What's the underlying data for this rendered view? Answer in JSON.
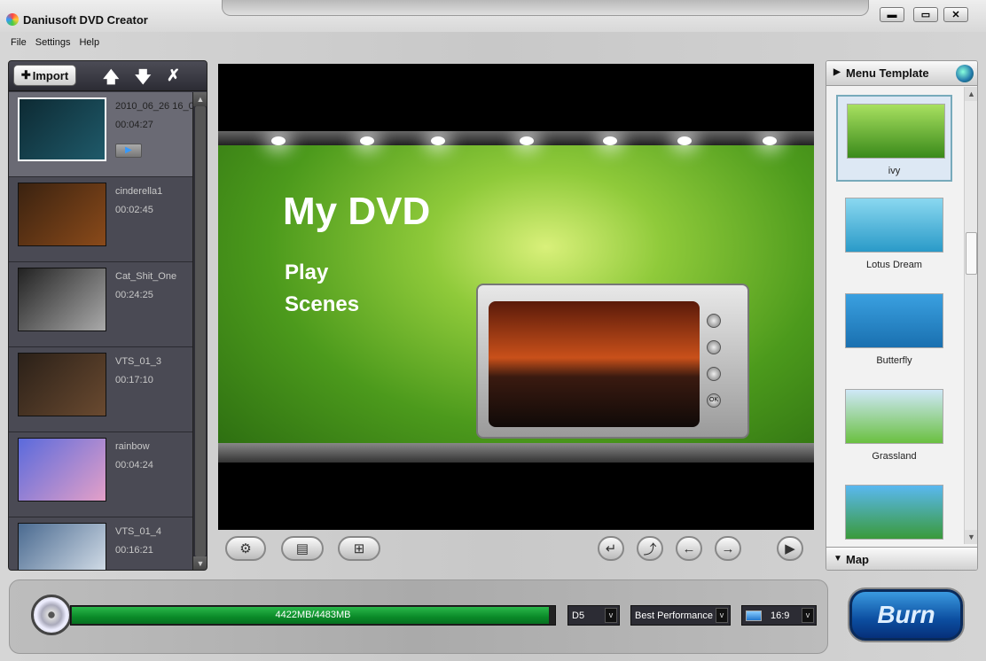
{
  "window": {
    "title": "Daniusoft DVD Creator",
    "minimize": "▬",
    "maximize": "▭",
    "close": "✕"
  },
  "menu": [
    "File",
    "Settings",
    "Help"
  ],
  "left_toolbar": {
    "import_label": "Import",
    "move_up": "🡅",
    "move_down": "🡇",
    "remove": "✗"
  },
  "videos": [
    {
      "name": "2010_06_26 16_0",
      "duration": "00:04:27",
      "colors": [
        "#0d2a33",
        "#1f5a6a"
      ],
      "selected": true
    },
    {
      "name": "cinderella1",
      "duration": "00:02:45",
      "colors": [
        "#3a2210",
        "#8a4a1a"
      ]
    },
    {
      "name": "Cat_Shit_One",
      "duration": "00:24:25",
      "colors": [
        "#222",
        "#aaa"
      ]
    },
    {
      "name": "VTS_01_3",
      "duration": "00:17:10",
      "colors": [
        "#2a2018",
        "#6a4a30"
      ]
    },
    {
      "name": "rainbow",
      "duration": "00:04:24",
      "colors": [
        "#5a6adc",
        "#e4a0c8"
      ]
    },
    {
      "name": "VTS_01_4",
      "duration": "00:16:21",
      "colors": [
        "#4a6a90",
        "#e0e8f0"
      ]
    }
  ],
  "preview": {
    "title": "My DVD",
    "links": [
      "Play",
      "Scenes"
    ],
    "tv_ok": "OK"
  },
  "controls": {
    "settings": "⚙",
    "chapters": "▤",
    "add": "⊞",
    "back": "↵",
    "up": "⤴",
    "prev": "←",
    "next": "→",
    "play": "▶"
  },
  "right_panel": {
    "header": "Menu Template",
    "map_label": "Map"
  },
  "templates": [
    {
      "name": "ivy",
      "colors": [
        "#a8e060",
        "#3a8a1a"
      ],
      "selected": true
    },
    {
      "name": "Lotus Dream",
      "colors": [
        "#8ad8f0",
        "#2a9ac8"
      ]
    },
    {
      "name": "Butterfly",
      "colors": [
        "#3aa0e0",
        "#1a70b0"
      ]
    },
    {
      "name": "Grassland",
      "colors": [
        "#cfe8f8",
        "#6ac040"
      ]
    },
    {
      "name": "",
      "colors": [
        "#5ab8f0",
        "#3a9a3a"
      ]
    }
  ],
  "bottom": {
    "capacity_text": "4422MB/4483MB",
    "capacity_fraction": 0.986,
    "disc_type": "D5",
    "quality": "Best Performance",
    "aspect": "16:9",
    "burn_label": "Burn",
    "dropdown_arrow": "v"
  }
}
